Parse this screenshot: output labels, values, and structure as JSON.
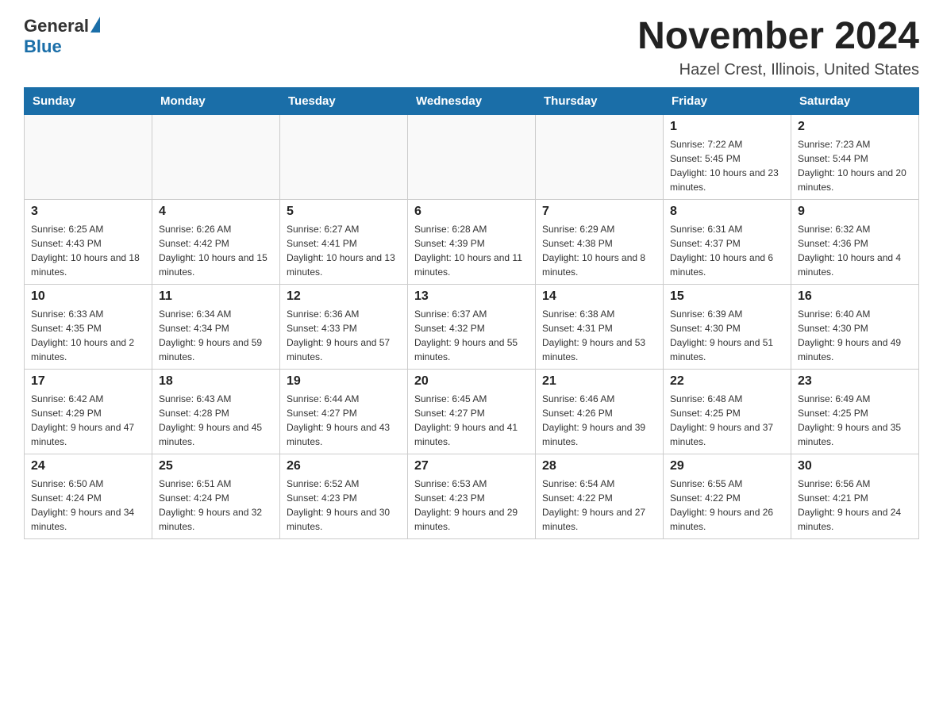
{
  "logo": {
    "text_general": "General",
    "text_blue": "Blue"
  },
  "header": {
    "month_year": "November 2024",
    "location": "Hazel Crest, Illinois, United States"
  },
  "weekdays": [
    "Sunday",
    "Monday",
    "Tuesday",
    "Wednesday",
    "Thursday",
    "Friday",
    "Saturday"
  ],
  "weeks": [
    [
      {
        "day": "",
        "sunrise": "",
        "sunset": "",
        "daylight": ""
      },
      {
        "day": "",
        "sunrise": "",
        "sunset": "",
        "daylight": ""
      },
      {
        "day": "",
        "sunrise": "",
        "sunset": "",
        "daylight": ""
      },
      {
        "day": "",
        "sunrise": "",
        "sunset": "",
        "daylight": ""
      },
      {
        "day": "",
        "sunrise": "",
        "sunset": "",
        "daylight": ""
      },
      {
        "day": "1",
        "sunrise": "Sunrise: 7:22 AM",
        "sunset": "Sunset: 5:45 PM",
        "daylight": "Daylight: 10 hours and 23 minutes."
      },
      {
        "day": "2",
        "sunrise": "Sunrise: 7:23 AM",
        "sunset": "Sunset: 5:44 PM",
        "daylight": "Daylight: 10 hours and 20 minutes."
      }
    ],
    [
      {
        "day": "3",
        "sunrise": "Sunrise: 6:25 AM",
        "sunset": "Sunset: 4:43 PM",
        "daylight": "Daylight: 10 hours and 18 minutes."
      },
      {
        "day": "4",
        "sunrise": "Sunrise: 6:26 AM",
        "sunset": "Sunset: 4:42 PM",
        "daylight": "Daylight: 10 hours and 15 minutes."
      },
      {
        "day": "5",
        "sunrise": "Sunrise: 6:27 AM",
        "sunset": "Sunset: 4:41 PM",
        "daylight": "Daylight: 10 hours and 13 minutes."
      },
      {
        "day": "6",
        "sunrise": "Sunrise: 6:28 AM",
        "sunset": "Sunset: 4:39 PM",
        "daylight": "Daylight: 10 hours and 11 minutes."
      },
      {
        "day": "7",
        "sunrise": "Sunrise: 6:29 AM",
        "sunset": "Sunset: 4:38 PM",
        "daylight": "Daylight: 10 hours and 8 minutes."
      },
      {
        "day": "8",
        "sunrise": "Sunrise: 6:31 AM",
        "sunset": "Sunset: 4:37 PM",
        "daylight": "Daylight: 10 hours and 6 minutes."
      },
      {
        "day": "9",
        "sunrise": "Sunrise: 6:32 AM",
        "sunset": "Sunset: 4:36 PM",
        "daylight": "Daylight: 10 hours and 4 minutes."
      }
    ],
    [
      {
        "day": "10",
        "sunrise": "Sunrise: 6:33 AM",
        "sunset": "Sunset: 4:35 PM",
        "daylight": "Daylight: 10 hours and 2 minutes."
      },
      {
        "day": "11",
        "sunrise": "Sunrise: 6:34 AM",
        "sunset": "Sunset: 4:34 PM",
        "daylight": "Daylight: 9 hours and 59 minutes."
      },
      {
        "day": "12",
        "sunrise": "Sunrise: 6:36 AM",
        "sunset": "Sunset: 4:33 PM",
        "daylight": "Daylight: 9 hours and 57 minutes."
      },
      {
        "day": "13",
        "sunrise": "Sunrise: 6:37 AM",
        "sunset": "Sunset: 4:32 PM",
        "daylight": "Daylight: 9 hours and 55 minutes."
      },
      {
        "day": "14",
        "sunrise": "Sunrise: 6:38 AM",
        "sunset": "Sunset: 4:31 PM",
        "daylight": "Daylight: 9 hours and 53 minutes."
      },
      {
        "day": "15",
        "sunrise": "Sunrise: 6:39 AM",
        "sunset": "Sunset: 4:30 PM",
        "daylight": "Daylight: 9 hours and 51 minutes."
      },
      {
        "day": "16",
        "sunrise": "Sunrise: 6:40 AM",
        "sunset": "Sunset: 4:30 PM",
        "daylight": "Daylight: 9 hours and 49 minutes."
      }
    ],
    [
      {
        "day": "17",
        "sunrise": "Sunrise: 6:42 AM",
        "sunset": "Sunset: 4:29 PM",
        "daylight": "Daylight: 9 hours and 47 minutes."
      },
      {
        "day": "18",
        "sunrise": "Sunrise: 6:43 AM",
        "sunset": "Sunset: 4:28 PM",
        "daylight": "Daylight: 9 hours and 45 minutes."
      },
      {
        "day": "19",
        "sunrise": "Sunrise: 6:44 AM",
        "sunset": "Sunset: 4:27 PM",
        "daylight": "Daylight: 9 hours and 43 minutes."
      },
      {
        "day": "20",
        "sunrise": "Sunrise: 6:45 AM",
        "sunset": "Sunset: 4:27 PM",
        "daylight": "Daylight: 9 hours and 41 minutes."
      },
      {
        "day": "21",
        "sunrise": "Sunrise: 6:46 AM",
        "sunset": "Sunset: 4:26 PM",
        "daylight": "Daylight: 9 hours and 39 minutes."
      },
      {
        "day": "22",
        "sunrise": "Sunrise: 6:48 AM",
        "sunset": "Sunset: 4:25 PM",
        "daylight": "Daylight: 9 hours and 37 minutes."
      },
      {
        "day": "23",
        "sunrise": "Sunrise: 6:49 AM",
        "sunset": "Sunset: 4:25 PM",
        "daylight": "Daylight: 9 hours and 35 minutes."
      }
    ],
    [
      {
        "day": "24",
        "sunrise": "Sunrise: 6:50 AM",
        "sunset": "Sunset: 4:24 PM",
        "daylight": "Daylight: 9 hours and 34 minutes."
      },
      {
        "day": "25",
        "sunrise": "Sunrise: 6:51 AM",
        "sunset": "Sunset: 4:24 PM",
        "daylight": "Daylight: 9 hours and 32 minutes."
      },
      {
        "day": "26",
        "sunrise": "Sunrise: 6:52 AM",
        "sunset": "Sunset: 4:23 PM",
        "daylight": "Daylight: 9 hours and 30 minutes."
      },
      {
        "day": "27",
        "sunrise": "Sunrise: 6:53 AM",
        "sunset": "Sunset: 4:23 PM",
        "daylight": "Daylight: 9 hours and 29 minutes."
      },
      {
        "day": "28",
        "sunrise": "Sunrise: 6:54 AM",
        "sunset": "Sunset: 4:22 PM",
        "daylight": "Daylight: 9 hours and 27 minutes."
      },
      {
        "day": "29",
        "sunrise": "Sunrise: 6:55 AM",
        "sunset": "Sunset: 4:22 PM",
        "daylight": "Daylight: 9 hours and 26 minutes."
      },
      {
        "day": "30",
        "sunrise": "Sunrise: 6:56 AM",
        "sunset": "Sunset: 4:21 PM",
        "daylight": "Daylight: 9 hours and 24 minutes."
      }
    ]
  ]
}
